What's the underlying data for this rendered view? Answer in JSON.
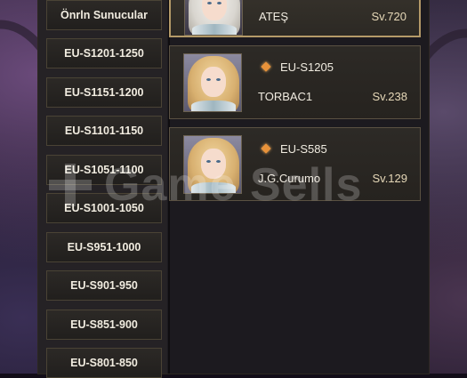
{
  "servers": {
    "recommended_label": "Önrln Sunucular",
    "items": [
      {
        "label": "EU-S1201-1250"
      },
      {
        "label": "EU-S1151-1200"
      },
      {
        "label": "EU-S1101-1150"
      },
      {
        "label": "EU-S1051-1100"
      },
      {
        "label": "EU-S1001-1050"
      },
      {
        "label": "EU-S951-1000"
      },
      {
        "label": "EU-S901-950"
      },
      {
        "label": "EU-S851-900"
      },
      {
        "label": "EU-S801-850"
      }
    ]
  },
  "characters": [
    {
      "server": "",
      "name": "ATEŞ",
      "level": "Sv.720",
      "avatar": "white-hair-elf-portrait",
      "selected": true
    },
    {
      "server": "EU-S1205",
      "name": "TORBAC1",
      "level": "Sv.238",
      "avatar": "blonde-elf-portrait",
      "icon": "diamond-icon"
    },
    {
      "server": "EU-S585",
      "name": "J.G.Curumo",
      "level": "Sv.129",
      "avatar": "blonde-elf-portrait",
      "icon": "diamond-icon"
    }
  ],
  "watermark": "Game Sells"
}
